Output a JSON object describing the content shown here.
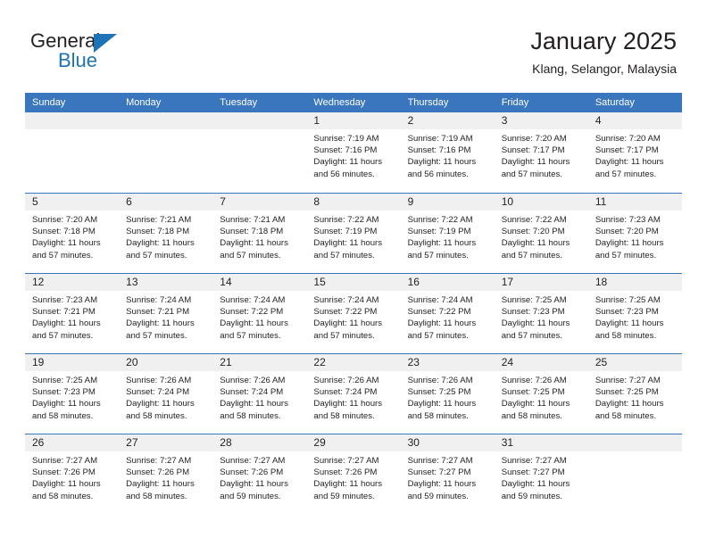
{
  "logo": {
    "word_top": "General",
    "word_bottom": "Blue",
    "triangle_color": "#1d72b8",
    "text_color": "#231f20"
  },
  "header": {
    "title": "January 2025",
    "subtitle": "Klang, Selangor, Malaysia"
  },
  "theme": {
    "header_blue": "#3a76bd",
    "row_rule_blue": "#3a76bd",
    "daynum_band": "#f0f0f0",
    "text": "#231f20",
    "background": "#ffffff"
  },
  "calendar": {
    "day_headers": [
      "Sunday",
      "Monday",
      "Tuesday",
      "Wednesday",
      "Thursday",
      "Friday",
      "Saturday"
    ],
    "weeks": [
      [
        {
          "day": "",
          "lines": []
        },
        {
          "day": "",
          "lines": []
        },
        {
          "day": "",
          "lines": []
        },
        {
          "day": "1",
          "lines": [
            "Sunrise: 7:19 AM",
            "Sunset: 7:16 PM",
            "Daylight: 11 hours",
            "and 56 minutes."
          ]
        },
        {
          "day": "2",
          "lines": [
            "Sunrise: 7:19 AM",
            "Sunset: 7:16 PM",
            "Daylight: 11 hours",
            "and 56 minutes."
          ]
        },
        {
          "day": "3",
          "lines": [
            "Sunrise: 7:20 AM",
            "Sunset: 7:17 PM",
            "Daylight: 11 hours",
            "and 57 minutes."
          ]
        },
        {
          "day": "4",
          "lines": [
            "Sunrise: 7:20 AM",
            "Sunset: 7:17 PM",
            "Daylight: 11 hours",
            "and 57 minutes."
          ]
        }
      ],
      [
        {
          "day": "5",
          "lines": [
            "Sunrise: 7:20 AM",
            "Sunset: 7:18 PM",
            "Daylight: 11 hours",
            "and 57 minutes."
          ]
        },
        {
          "day": "6",
          "lines": [
            "Sunrise: 7:21 AM",
            "Sunset: 7:18 PM",
            "Daylight: 11 hours",
            "and 57 minutes."
          ]
        },
        {
          "day": "7",
          "lines": [
            "Sunrise: 7:21 AM",
            "Sunset: 7:18 PM",
            "Daylight: 11 hours",
            "and 57 minutes."
          ]
        },
        {
          "day": "8",
          "lines": [
            "Sunrise: 7:22 AM",
            "Sunset: 7:19 PM",
            "Daylight: 11 hours",
            "and 57 minutes."
          ]
        },
        {
          "day": "9",
          "lines": [
            "Sunrise: 7:22 AM",
            "Sunset: 7:19 PM",
            "Daylight: 11 hours",
            "and 57 minutes."
          ]
        },
        {
          "day": "10",
          "lines": [
            "Sunrise: 7:22 AM",
            "Sunset: 7:20 PM",
            "Daylight: 11 hours",
            "and 57 minutes."
          ]
        },
        {
          "day": "11",
          "lines": [
            "Sunrise: 7:23 AM",
            "Sunset: 7:20 PM",
            "Daylight: 11 hours",
            "and 57 minutes."
          ]
        }
      ],
      [
        {
          "day": "12",
          "lines": [
            "Sunrise: 7:23 AM",
            "Sunset: 7:21 PM",
            "Daylight: 11 hours",
            "and 57 minutes."
          ]
        },
        {
          "day": "13",
          "lines": [
            "Sunrise: 7:24 AM",
            "Sunset: 7:21 PM",
            "Daylight: 11 hours",
            "and 57 minutes."
          ]
        },
        {
          "day": "14",
          "lines": [
            "Sunrise: 7:24 AM",
            "Sunset: 7:22 PM",
            "Daylight: 11 hours",
            "and 57 minutes."
          ]
        },
        {
          "day": "15",
          "lines": [
            "Sunrise: 7:24 AM",
            "Sunset: 7:22 PM",
            "Daylight: 11 hours",
            "and 57 minutes."
          ]
        },
        {
          "day": "16",
          "lines": [
            "Sunrise: 7:24 AM",
            "Sunset: 7:22 PM",
            "Daylight: 11 hours",
            "and 57 minutes."
          ]
        },
        {
          "day": "17",
          "lines": [
            "Sunrise: 7:25 AM",
            "Sunset: 7:23 PM",
            "Daylight: 11 hours",
            "and 57 minutes."
          ]
        },
        {
          "day": "18",
          "lines": [
            "Sunrise: 7:25 AM",
            "Sunset: 7:23 PM",
            "Daylight: 11 hours",
            "and 58 minutes."
          ]
        }
      ],
      [
        {
          "day": "19",
          "lines": [
            "Sunrise: 7:25 AM",
            "Sunset: 7:23 PM",
            "Daylight: 11 hours",
            "and 58 minutes."
          ]
        },
        {
          "day": "20",
          "lines": [
            "Sunrise: 7:26 AM",
            "Sunset: 7:24 PM",
            "Daylight: 11 hours",
            "and 58 minutes."
          ]
        },
        {
          "day": "21",
          "lines": [
            "Sunrise: 7:26 AM",
            "Sunset: 7:24 PM",
            "Daylight: 11 hours",
            "and 58 minutes."
          ]
        },
        {
          "day": "22",
          "lines": [
            "Sunrise: 7:26 AM",
            "Sunset: 7:24 PM",
            "Daylight: 11 hours",
            "and 58 minutes."
          ]
        },
        {
          "day": "23",
          "lines": [
            "Sunrise: 7:26 AM",
            "Sunset: 7:25 PM",
            "Daylight: 11 hours",
            "and 58 minutes."
          ]
        },
        {
          "day": "24",
          "lines": [
            "Sunrise: 7:26 AM",
            "Sunset: 7:25 PM",
            "Daylight: 11 hours",
            "and 58 minutes."
          ]
        },
        {
          "day": "25",
          "lines": [
            "Sunrise: 7:27 AM",
            "Sunset: 7:25 PM",
            "Daylight: 11 hours",
            "and 58 minutes."
          ]
        }
      ],
      [
        {
          "day": "26",
          "lines": [
            "Sunrise: 7:27 AM",
            "Sunset: 7:26 PM",
            "Daylight: 11 hours",
            "and 58 minutes."
          ]
        },
        {
          "day": "27",
          "lines": [
            "Sunrise: 7:27 AM",
            "Sunset: 7:26 PM",
            "Daylight: 11 hours",
            "and 58 minutes."
          ]
        },
        {
          "day": "28",
          "lines": [
            "Sunrise: 7:27 AM",
            "Sunset: 7:26 PM",
            "Daylight: 11 hours",
            "and 59 minutes."
          ]
        },
        {
          "day": "29",
          "lines": [
            "Sunrise: 7:27 AM",
            "Sunset: 7:26 PM",
            "Daylight: 11 hours",
            "and 59 minutes."
          ]
        },
        {
          "day": "30",
          "lines": [
            "Sunrise: 7:27 AM",
            "Sunset: 7:27 PM",
            "Daylight: 11 hours",
            "and 59 minutes."
          ]
        },
        {
          "day": "31",
          "lines": [
            "Sunrise: 7:27 AM",
            "Sunset: 7:27 PM",
            "Daylight: 11 hours",
            "and 59 minutes."
          ]
        },
        {
          "day": "",
          "lines": []
        }
      ]
    ]
  }
}
